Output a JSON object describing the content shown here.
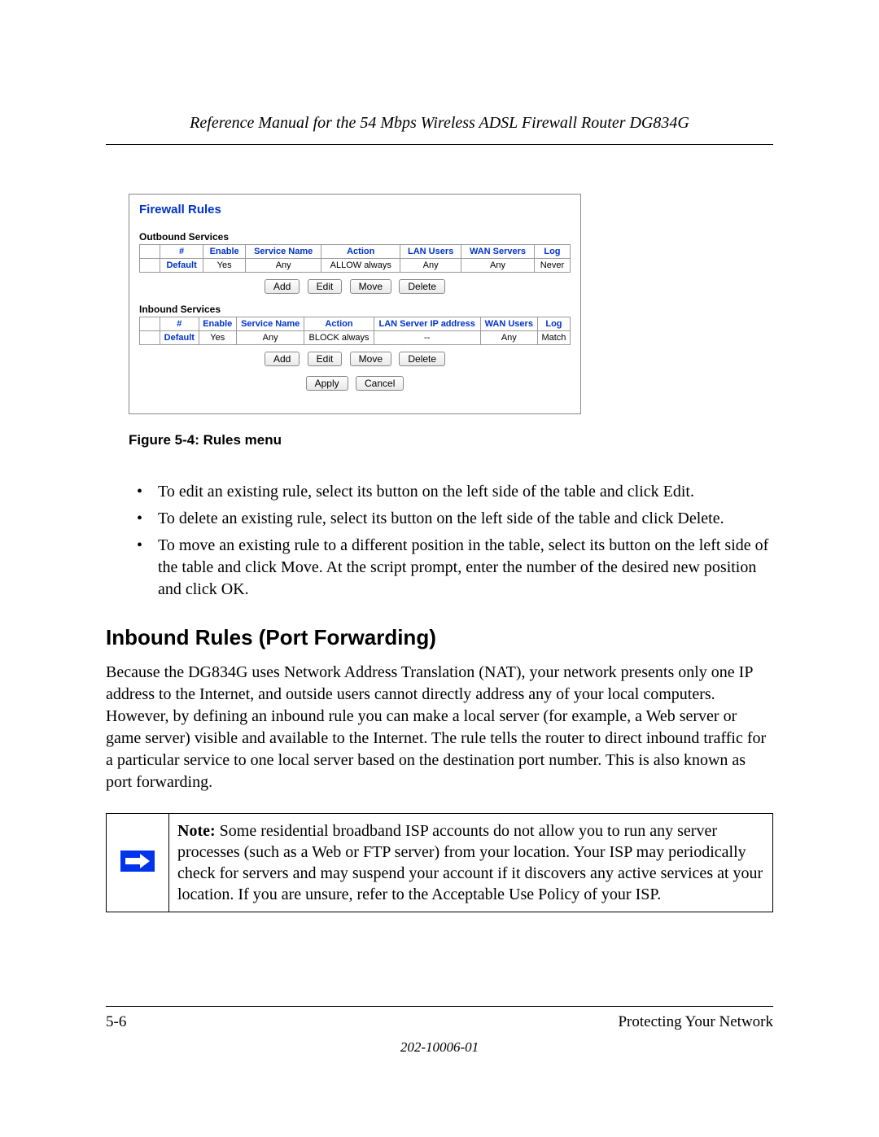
{
  "header": {
    "running_title": "Reference Manual for the 54 Mbps Wireless ADSL Firewall Router DG834G"
  },
  "screenshot": {
    "title": "Firewall Rules",
    "outbound": {
      "label": "Outbound Services",
      "headers": [
        "",
        "#",
        "Enable",
        "Service Name",
        "Action",
        "LAN Users",
        "WAN Servers",
        "Log"
      ],
      "row": [
        "",
        "Default",
        "Yes",
        "Any",
        "ALLOW always",
        "Any",
        "Any",
        "Never"
      ]
    },
    "inbound": {
      "label": "Inbound Services",
      "headers": [
        "",
        "#",
        "Enable",
        "Service Name",
        "Action",
        "LAN Server IP address",
        "WAN Users",
        "Log"
      ],
      "row": [
        "",
        "Default",
        "Yes",
        "Any",
        "BLOCK always",
        "--",
        "Any",
        "Match"
      ]
    },
    "buttons": {
      "add": "Add",
      "edit": "Edit",
      "move": "Move",
      "delete": "Delete",
      "apply": "Apply",
      "cancel": "Cancel"
    }
  },
  "figure_caption": "Figure 5-4:  Rules menu",
  "bullets": [
    "To edit an existing rule, select its button on the left side of the table and click Edit.",
    "To delete an existing rule, select its button on the left side of the table and click Delete.",
    "To move an existing rule to a different position in the table, select its button on the left side of the table and click Move. At the script prompt, enter the number of the desired new position and click OK."
  ],
  "section_heading": "Inbound Rules (Port Forwarding)",
  "body_para": "Because the DG834G uses Network Address Translation (NAT), your network presents only one IP address to the Internet, and outside users cannot directly address any of your local computers. However, by defining an inbound rule you can make a local server (for example, a Web server or game server) visible and available to the Internet. The rule tells the router to direct inbound traffic for a particular service to one local server based on the destination port number. This is also known as port forwarding.",
  "note": {
    "label": "Note:",
    "text": " Some residential broadband ISP accounts do not allow you to run any server processes (such as a Web or FTP server) from your location. Your ISP may periodically check for servers and may suspend your account if it discovers any active services at your location. If you are unsure, refer to the Acceptable Use Policy of your ISP."
  },
  "footer": {
    "page": "5-6",
    "chapter": "Protecting Your Network",
    "doc_number": "202-10006-01"
  }
}
